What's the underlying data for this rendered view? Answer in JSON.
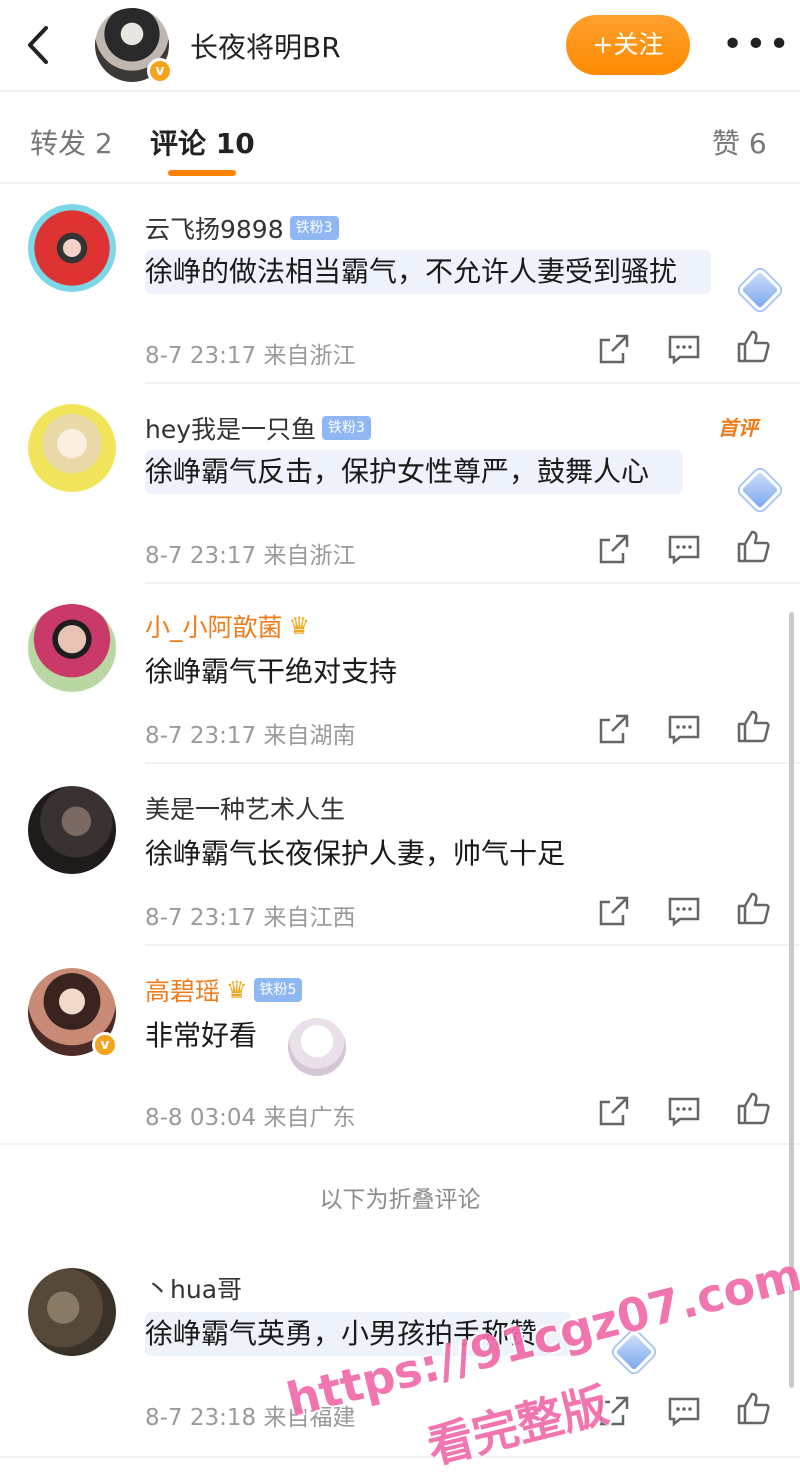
{
  "header": {
    "back_icon": "chevron-left-icon",
    "user_name": "长夜将明BR",
    "follow_label": "+关注",
    "more_icon": "more-horizontal-icon"
  },
  "tabs": [
    {
      "label": "转发 2"
    },
    {
      "label": "评论 10"
    },
    {
      "label": "赞 6"
    }
  ],
  "comments": [
    {
      "name": "云飞扬9898",
      "badge": "铁粉3",
      "text": "徐峥的做法相当霸气，不允许人妻受到骚扰",
      "time": "8-7 23:17",
      "location": "来自浙江"
    },
    {
      "name": "hey我是一只鱼",
      "badge": "铁粉3",
      "first": "首评",
      "text": "徐峥霸气反击，保护女性尊严，鼓舞人心",
      "time": "8-7 23:17",
      "location": "来自浙江"
    },
    {
      "name": "小_小阿歆菌",
      "text": "徐峥霸气干绝对支持",
      "time": "8-7 23:17",
      "location": "来自湖南"
    },
    {
      "name": "美是一种艺术人生",
      "text": "徐峥霸气长夜保护人妻，帅气十足",
      "time": "8-7 23:17",
      "location": "来自江西"
    },
    {
      "name": "高碧瑶",
      "badge": "铁粉5",
      "text": "非常好看",
      "time": "8-8 03:04",
      "location": "来自广东"
    }
  ],
  "folded_label": "以下为折叠评论",
  "folded_comments": [
    {
      "name": "丶hua哥",
      "text": "徐峥霸气英勇，小男孩拍手称赞",
      "time": "8-7 23:18",
      "location": "来自福建"
    }
  ],
  "actions": {
    "share_icon": "share-icon",
    "comment_icon": "comment-icon",
    "like_icon": "thumbs-up-icon"
  },
  "watermark": {
    "line1": "https://91cgz07.com",
    "line2": "看完整版"
  },
  "colors": {
    "accent": "#ff8200",
    "name_orange": "#f07c1c",
    "fan_badge": "#8fb7f2",
    "watermark": "#f06aa8"
  }
}
